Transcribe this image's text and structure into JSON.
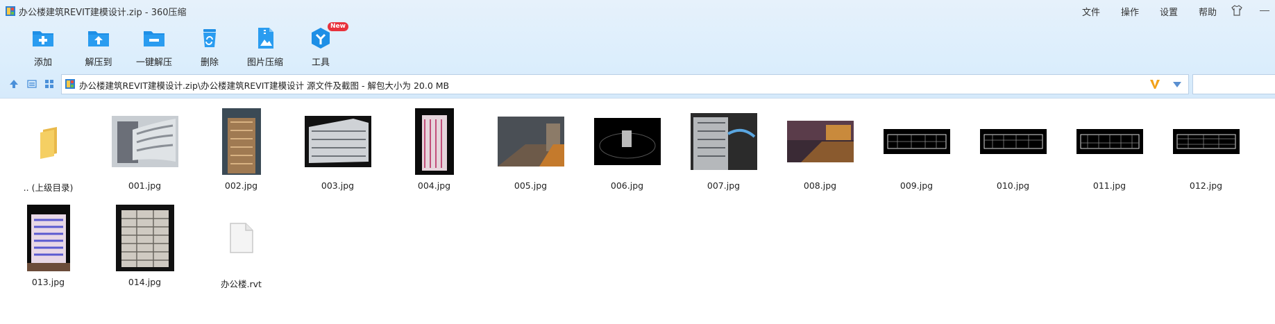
{
  "window": {
    "title": "办公楼建筑REVIT建模设计.zip - 360压缩",
    "menu": [
      "文件",
      "操作",
      "设置",
      "帮助"
    ]
  },
  "toolbar": {
    "add": "添加",
    "extract_to": "解压到",
    "one_click_extract": "一键解压",
    "delete": "删除",
    "image_compress": "图片压缩",
    "tools": "工具",
    "tools_badge": "New"
  },
  "address": {
    "path": "办公楼建筑REVIT建模设计.zip\\办公楼建筑REVIT建模设计 源文件及截图 - 解包大小为 20.0 MB"
  },
  "files": [
    {
      "name": ".. (上级目录)",
      "kind": "folder-up"
    },
    {
      "name": "001.jpg",
      "kind": "image"
    },
    {
      "name": "002.jpg",
      "kind": "image"
    },
    {
      "name": "003.jpg",
      "kind": "image"
    },
    {
      "name": "004.jpg",
      "kind": "image"
    },
    {
      "name": "005.jpg",
      "kind": "image"
    },
    {
      "name": "006.jpg",
      "kind": "image"
    },
    {
      "name": "007.jpg",
      "kind": "image"
    },
    {
      "name": "008.jpg",
      "kind": "image"
    },
    {
      "name": "009.jpg",
      "kind": "image"
    },
    {
      "name": "010.jpg",
      "kind": "image"
    },
    {
      "name": "011.jpg",
      "kind": "image"
    },
    {
      "name": "012.jpg",
      "kind": "image"
    },
    {
      "name": "013.jpg",
      "kind": "image"
    },
    {
      "name": "014.jpg",
      "kind": "image"
    },
    {
      "name": "办公楼.rvt",
      "kind": "document"
    }
  ],
  "colors": {
    "accent": "#1e8fe6",
    "badge": "#e8323c",
    "folder": "#f5cf63",
    "v_icon": "#f3a21a"
  }
}
